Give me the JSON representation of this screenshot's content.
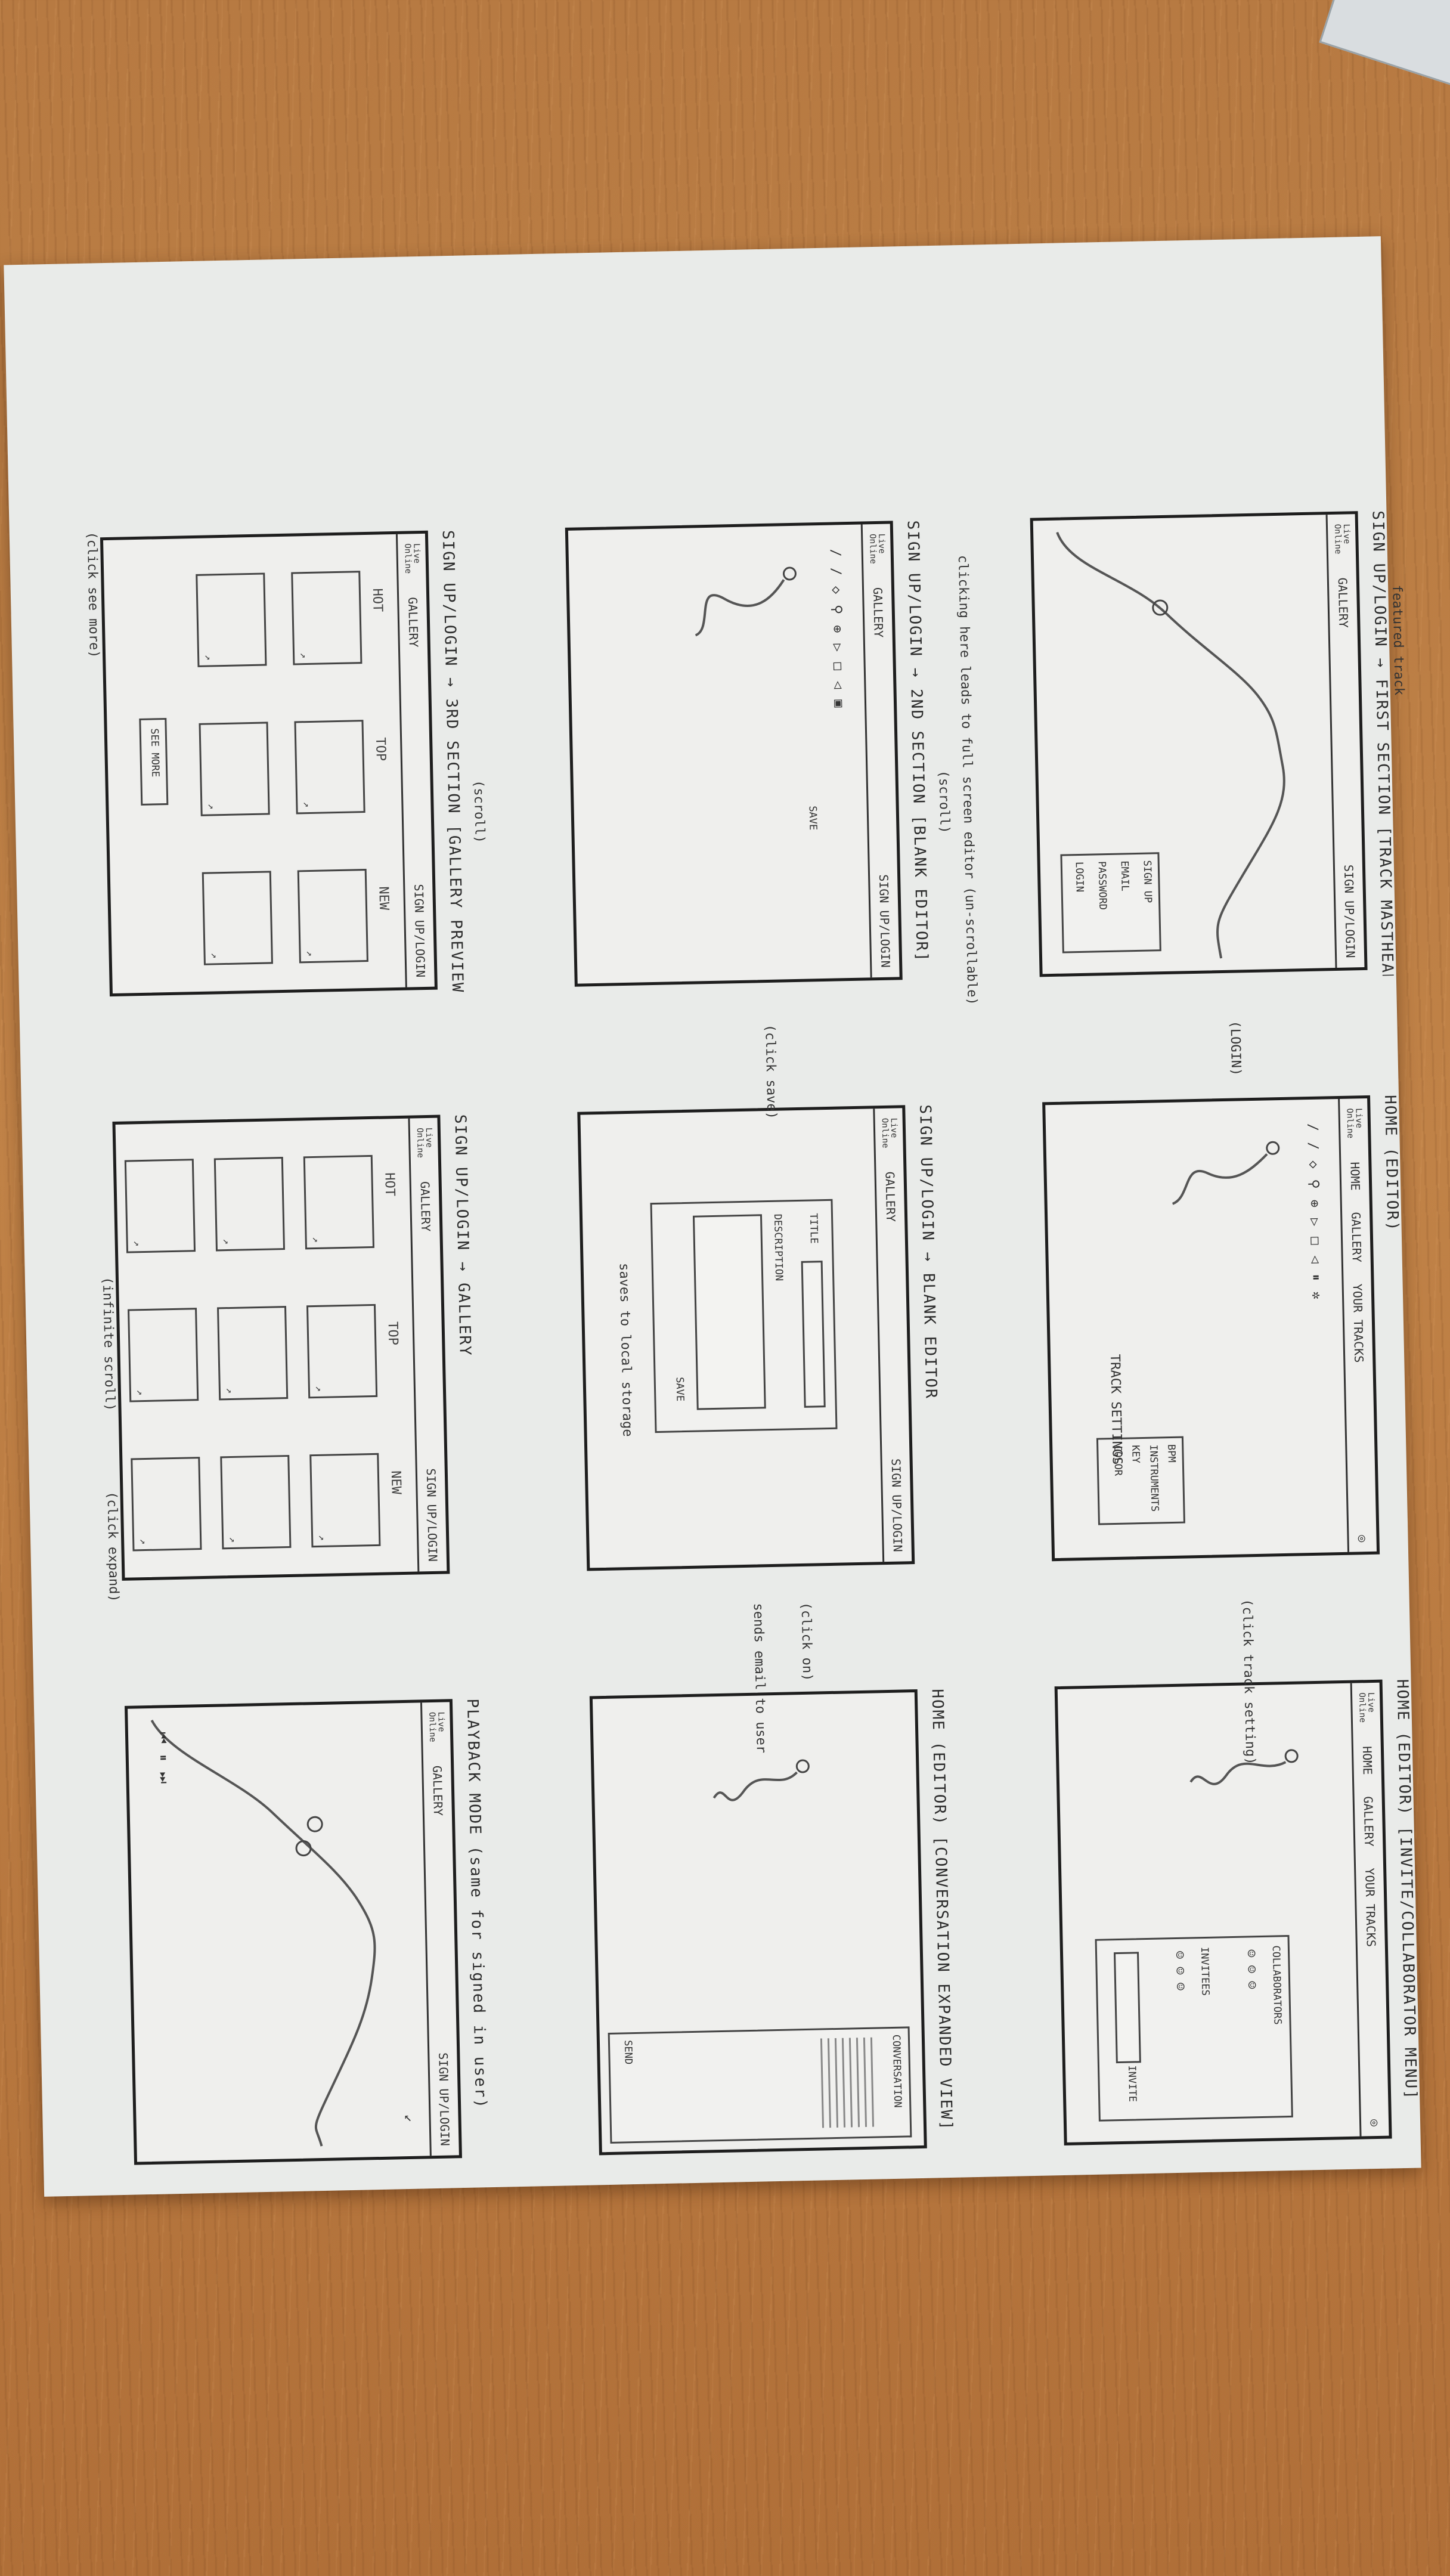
{
  "sheet": {
    "panels": [
      {
        "id": "p1",
        "title": "SIGN UP/LOGIN → FIRST SECTION [TRACK MASTHEAD]",
        "nav": [
          "Live Online",
          "GALLERY",
          "SIGN UP/LOGIN"
        ],
        "notes": [
          "featured track"
        ],
        "form": [
          "SIGN UP",
          "EMAIL",
          "PASSWORD",
          "LOGIN"
        ]
      },
      {
        "id": "p2",
        "title": "HOME (EDITOR)",
        "nav": [
          "Live Online",
          "HOME",
          "GALLERY",
          "YOUR TRACKS"
        ],
        "notes": [
          "TRACK SETTINGS",
          "(LOGIN)"
        ],
        "settings": [
          "BPM",
          "INSTRUMENTS",
          "KEY",
          "COLOR"
        ]
      },
      {
        "id": "p3",
        "title": "HOME (EDITOR) [INVITE/COLLABORATOR MENU]",
        "nav": [
          "Live Online",
          "HOME",
          "GALLERY",
          "YOUR TRACKS"
        ],
        "notes": [
          "(click track setting)"
        ],
        "menu": [
          "COLLABORATORS",
          "INVITEES",
          "INVITE"
        ]
      },
      {
        "id": "p4",
        "title": "SIGN UP/LOGIN → 2ND SECTION [BLANK EDITOR]",
        "nav": [
          "Live Online",
          "GALLERY",
          "SIGN UP/LOGIN"
        ],
        "notes": [
          "clicking here leads to full screen editor (un-scrollable)",
          "(scroll)",
          "SAVE"
        ]
      },
      {
        "id": "p5",
        "title": "SIGN UP/LOGIN → BLANK EDITOR",
        "nav": [
          "Live Online",
          "GALLERY",
          "SIGN UP/LOGIN"
        ],
        "notes": [
          "(click save)",
          "saves to local storage"
        ],
        "form": [
          "TITLE",
          "DESCRIPTION",
          "SAVE"
        ]
      },
      {
        "id": "p6",
        "title": "HOME (EDITOR) [CONVERSATION EXPANDED VIEW]",
        "nav": [],
        "notes": [
          "(click on)",
          "sends email to user"
        ],
        "chat": [
          "CONVERSATION",
          "SEND"
        ]
      },
      {
        "id": "p7",
        "title": "SIGN UP/LOGIN → 3RD SECTION [GALLERY PREVIEW]",
        "nav": [
          "Live Online",
          "GALLERY",
          "SIGN UP/LOGIN"
        ],
        "notes": [
          "(scroll)",
          "(click see more)"
        ],
        "columns": [
          "HOT",
          "TOP",
          "NEW"
        ],
        "button": "SEE MORE"
      },
      {
        "id": "p8",
        "title": "SIGN UP/LOGIN → GALLERY",
        "nav": [
          "Live Online",
          "GALLERY",
          "SIGN UP/LOGIN"
        ],
        "notes": [
          "(infinite scroll)",
          "(click expand)"
        ],
        "columns": [
          "HOT",
          "TOP",
          "NEW"
        ]
      },
      {
        "id": "p9",
        "title": "PLAYBACK MODE (same for signed in user)",
        "nav": [
          "Live Online",
          "GALLERY",
          "SIGN UP/LOGIN"
        ],
        "notes": []
      }
    ]
  }
}
